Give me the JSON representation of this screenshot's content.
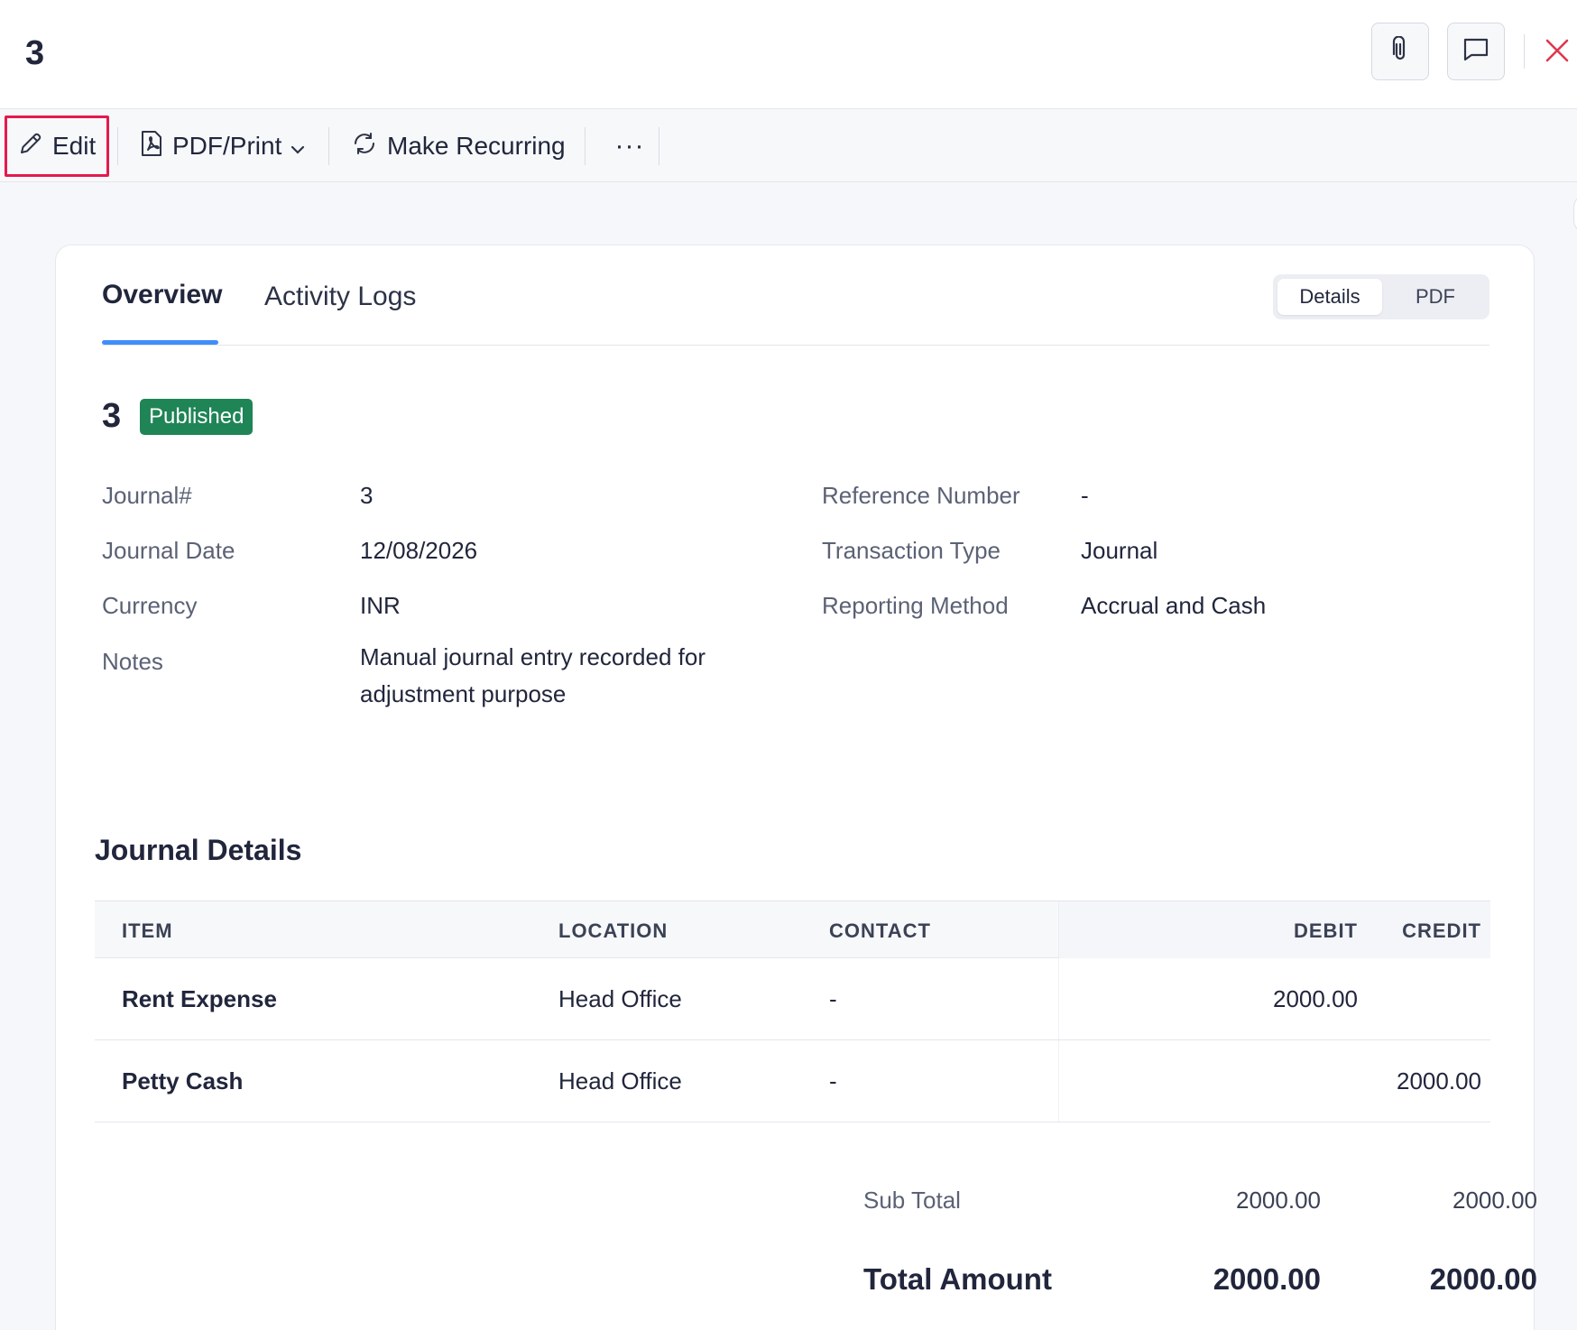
{
  "header": {
    "title": "3"
  },
  "toolbar": {
    "edit_label": "Edit",
    "pdf_label": "PDF/Print",
    "recurring_label": "Make Recurring",
    "more_label": "···"
  },
  "tabs": {
    "overview": "Overview",
    "activity": "Activity Logs"
  },
  "view_toggle": {
    "details": "Details",
    "pdf": "PDF"
  },
  "journal": {
    "number": "3",
    "status": "Published",
    "fields_left": [
      {
        "label": "Journal#",
        "value": "3"
      },
      {
        "label": "Journal Date",
        "value": "12/08/2026"
      },
      {
        "label": "Currency",
        "value": "INR"
      },
      {
        "label": "Notes",
        "value": "Manual journal entry recorded for adjustment purpose"
      }
    ],
    "fields_right": [
      {
        "label": "Reference Number",
        "value": "-"
      },
      {
        "label": "Transaction Type",
        "value": "Journal"
      },
      {
        "label": "Reporting Method",
        "value": "Accrual and Cash"
      }
    ]
  },
  "details": {
    "title": "Journal Details",
    "columns": {
      "item": "ITEM",
      "location": "LOCATION",
      "contact": "CONTACT",
      "debit": "DEBIT",
      "credit": "CREDIT"
    },
    "rows": [
      {
        "item": "Rent Expense",
        "location": "Head Office",
        "contact": "-",
        "debit": "2000.00",
        "credit": ""
      },
      {
        "item": "Petty Cash",
        "location": "Head Office",
        "contact": "-",
        "debit": "",
        "credit": "2000.00"
      }
    ],
    "subtotal": {
      "label": "Sub Total",
      "debit": "2000.00",
      "credit": "2000.00"
    },
    "total": {
      "label": "Total Amount",
      "debit": "2000.00",
      "credit": "2000.00"
    }
  },
  "colors": {
    "accent": "#408dfb",
    "status_published": "#1f8456",
    "highlight_border": "#e5194d",
    "close_icon": "#e0364f"
  }
}
